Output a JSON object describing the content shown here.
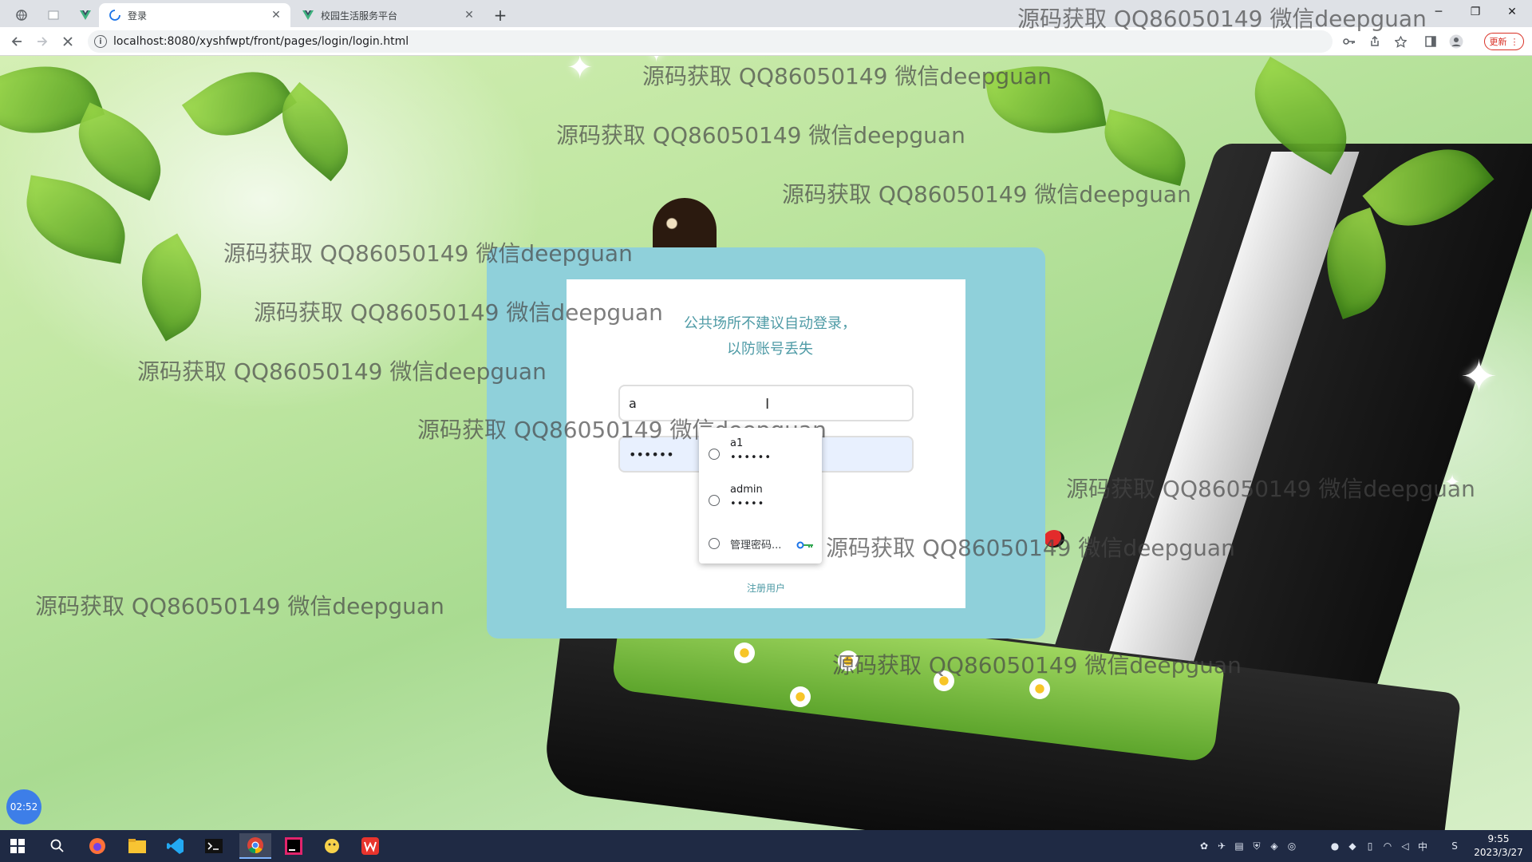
{
  "browser": {
    "tabs": [
      {
        "title": "",
        "pinned": true,
        "icon": "globe-icon"
      },
      {
        "title": "",
        "pinned": true,
        "icon": "blank-page-icon"
      },
      {
        "title": "",
        "pinned": true,
        "icon": "vue-logo-icon"
      },
      {
        "title": "登录",
        "pinned": false,
        "active": true,
        "icon": "loading-spinner-icon"
      },
      {
        "title": "校园生活服务平台",
        "pinned": false,
        "active": false,
        "icon": "vue-logo-icon"
      }
    ],
    "new_tab_label": "+",
    "window_controls": {
      "minimize": "─",
      "restore": "❐",
      "close": "✕"
    },
    "url": "localhost:8080/xyshfwpt/front/pages/login/login.html",
    "update_label": "更新"
  },
  "watermark": {
    "text": "源码获取 QQ86050149 微信deepguan"
  },
  "login": {
    "notice": "公共场所不建议自动登录，以防账号丢失",
    "username_value": "a",
    "password_value": "••••••",
    "register_link": "注册用户"
  },
  "autofill": {
    "suggestions": [
      {
        "user": "a1",
        "pass": "••••••"
      },
      {
        "user": "admin",
        "pass": "•••••"
      }
    ],
    "manage_label": "管理密码..."
  },
  "timer": "02:52",
  "taskbar": {
    "clock_time": "9:55",
    "clock_date": "2023/3/27",
    "ime": "中"
  }
}
